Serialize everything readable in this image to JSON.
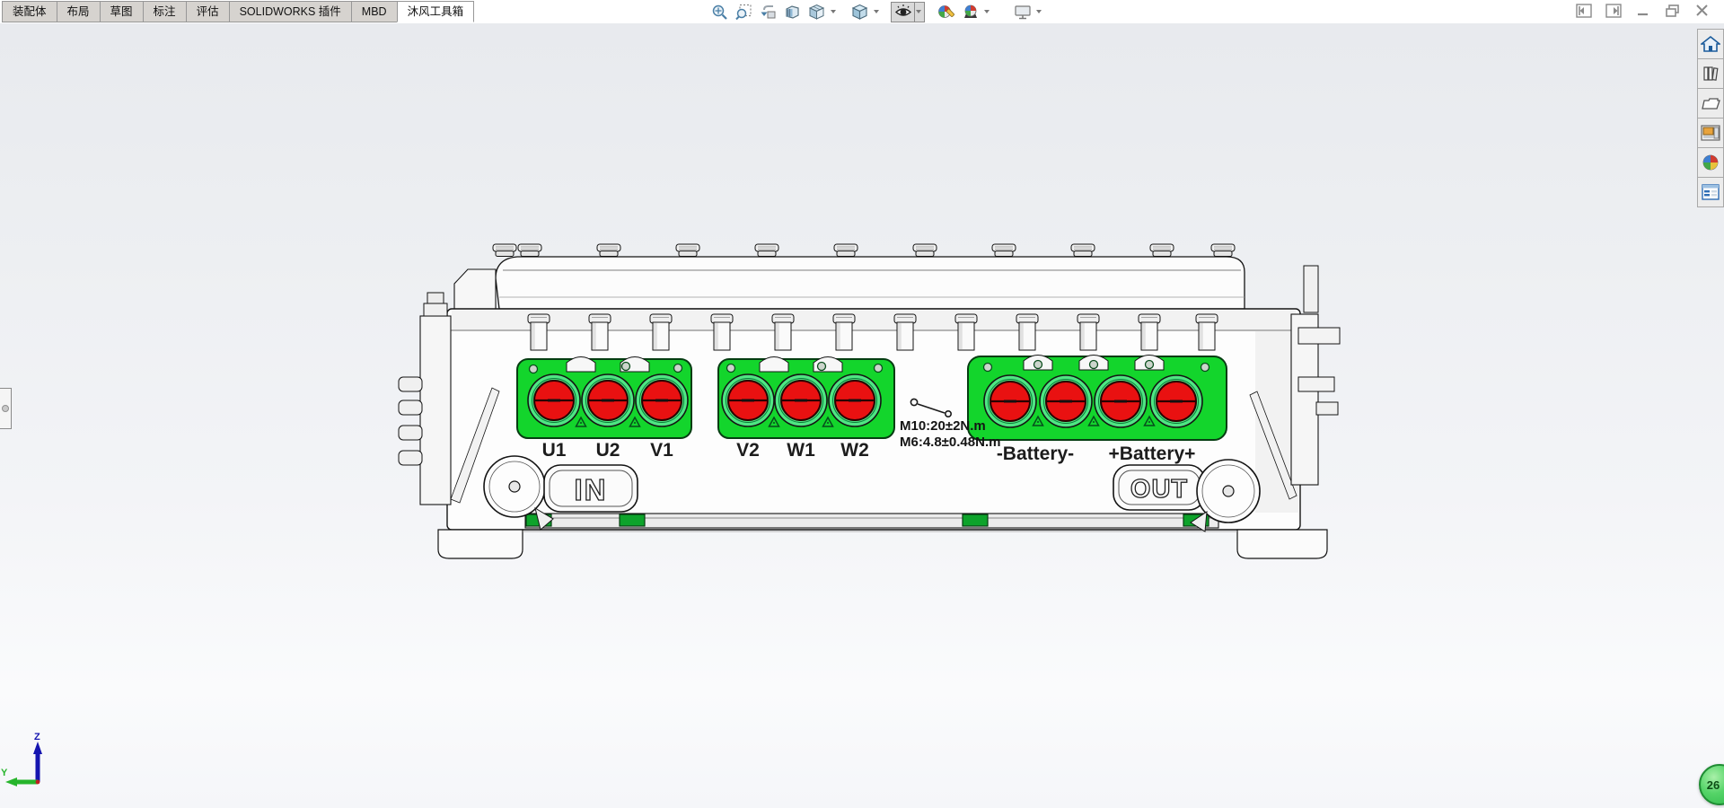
{
  "ribbon": {
    "tabs": [
      {
        "label": "装配体",
        "active": false
      },
      {
        "label": "布局",
        "active": false
      },
      {
        "label": "草图",
        "active": false
      },
      {
        "label": "标注",
        "active": false
      },
      {
        "label": "评估",
        "active": false
      },
      {
        "label": "SOLIDWORKS 插件",
        "active": false
      },
      {
        "label": "MBD",
        "active": false
      },
      {
        "label": "沐风工具箱",
        "active": true
      }
    ]
  },
  "headsup_toolbar": {
    "buttons": [
      {
        "name": "zoom-to-fit"
      },
      {
        "name": "zoom-to-area"
      },
      {
        "name": "previous-view"
      },
      {
        "name": "section-view"
      },
      {
        "name": "dynamic-annotation-views",
        "dropdown": true
      },
      {
        "name": "view-orientation",
        "dropdown": true
      },
      {
        "name": "display-style",
        "dropdown": true,
        "pressed": true
      },
      {
        "name": "edit-appearance"
      },
      {
        "name": "apply-scene",
        "dropdown": true
      },
      {
        "name": "view-settings",
        "dropdown": true
      }
    ]
  },
  "window_controls": [
    {
      "name": "collapse-left-pane"
    },
    {
      "name": "collapse-right-pane"
    },
    {
      "name": "minimize"
    },
    {
      "name": "restore"
    },
    {
      "name": "close"
    }
  ],
  "task_pane": {
    "items": [
      {
        "name": "solidworks-resources"
      },
      {
        "name": "design-library"
      },
      {
        "name": "file-explorer"
      },
      {
        "name": "view-palette"
      },
      {
        "name": "appearances-scenes"
      },
      {
        "name": "custom-properties"
      }
    ]
  },
  "model": {
    "phase_labels": [
      "U1",
      "U2",
      "V1",
      "V2",
      "W1",
      "W2"
    ],
    "battery_labels": [
      "-Battery-",
      "+Battery+"
    ],
    "torque_notes": [
      "M10:20±2N.m",
      "M6:4.8±0.48N.m"
    ],
    "coolant_in_label": "IN",
    "coolant_out_label": "OUT"
  },
  "orientation_triad": {
    "z_label": "Z",
    "y_label": "Y"
  },
  "notification_badge": {
    "count": "26"
  },
  "colors": {
    "connector_plate_green": "#13d52c",
    "port_ring_green": "#4fe683",
    "port_red": "#e91111",
    "clip_green": "#0ea32b",
    "viewport_top": "#e8eaee",
    "viewport_bottom": "#f5f6f9"
  }
}
